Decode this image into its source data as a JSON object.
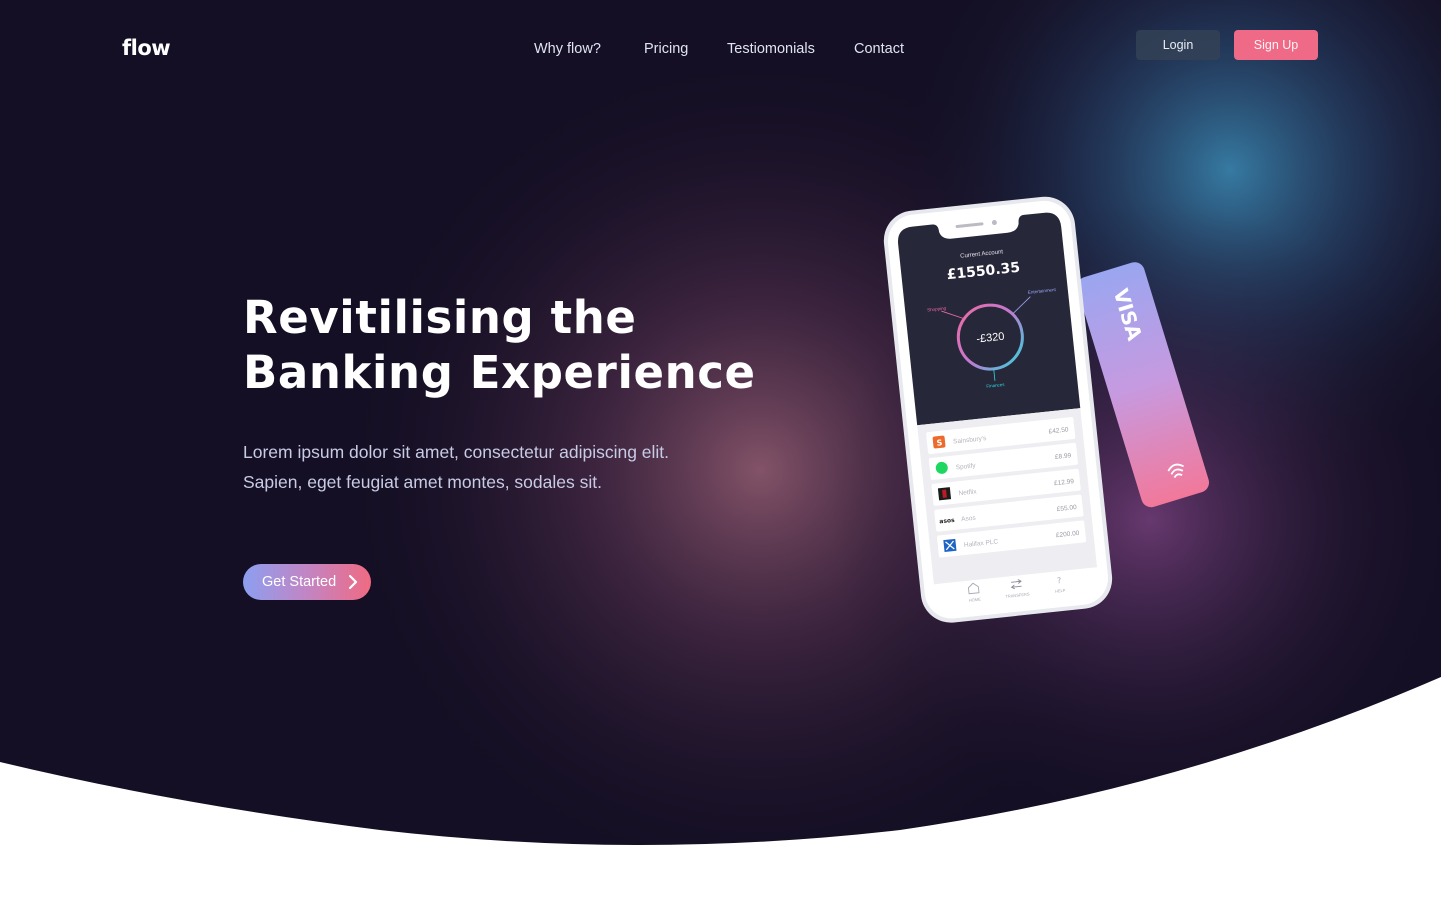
{
  "brand": {
    "logo": "flow"
  },
  "nav": {
    "links": [
      {
        "label": "Why flow?"
      },
      {
        "label": "Pricing"
      },
      {
        "label": "Testiomonials"
      },
      {
        "label": "Contact"
      }
    ],
    "login_label": "Login",
    "signup_label": "Sign Up"
  },
  "hero": {
    "headline_line1": "Revitilising the",
    "headline_line2": "Banking Experience",
    "sub_line1": "Lorem ipsum dolor sit amet, consectetur adipiscing elit.",
    "sub_line2": "Sapien, eget feugiat amet montes, sodales sit.",
    "cta_label": "Get Started",
    "cta_icon": "chevron-right-icon"
  },
  "phone": {
    "account_label": "Current Account",
    "balance": "£1550.35",
    "ring_value": "-£320",
    "ring_labels": {
      "shopping": "Shopping",
      "entertainment": "Entertainment",
      "finances": "Finances"
    },
    "transactions": [
      {
        "name": "Sainsbury's",
        "amount": "£42.50",
        "icon": "sainsburys-logo-icon",
        "color": "#ec6a2b"
      },
      {
        "name": "Spotify",
        "amount": "£8.99",
        "icon": "spotify-logo-icon",
        "color": "#1ed760"
      },
      {
        "name": "Netflix",
        "amount": "£12.99",
        "icon": "netflix-logo-icon",
        "color": "#b81d24"
      },
      {
        "name": "Asos",
        "amount": "£55.00",
        "icon": "asos-logo-icon",
        "color": "#222222"
      },
      {
        "name": "Halifax PLC",
        "amount": "£200.00",
        "icon": "halifax-logo-icon",
        "color": "#1f63c4"
      }
    ],
    "tabs": [
      {
        "label": "HOME",
        "icon": "home-icon"
      },
      {
        "label": "TRANSFERS",
        "icon": "transfer-arrows-icon"
      },
      {
        "label": "HELP",
        "icon": "question-icon"
      }
    ],
    "card_brand": "VISA",
    "card_icon": "contactless-icon"
  },
  "colors": {
    "background": "#140f24",
    "accent_pink": "#ef6a86",
    "accent_blue": "#8c9ff0",
    "ring_pink": "#ef6aa0",
    "ring_cyan": "#2fd6dc"
  }
}
